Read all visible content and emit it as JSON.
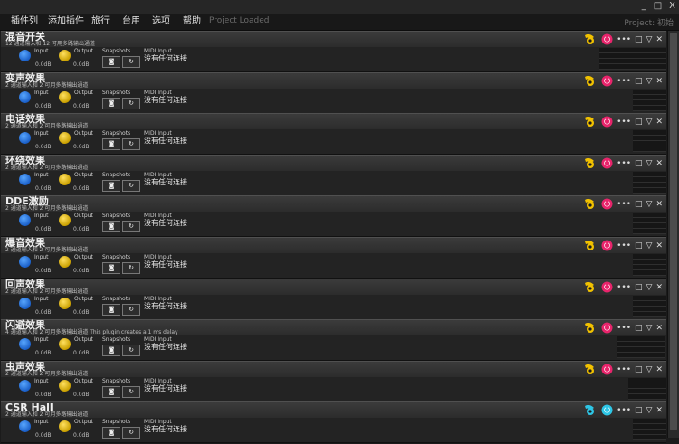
{
  "window": {
    "minimize": "_",
    "maximize": "□",
    "close": "X"
  },
  "menu": [
    "插件列",
    "添加插件",
    "旅行",
    "台用",
    "选项",
    "帮助"
  ],
  "project_status": "Project Loaded",
  "project_name": "Project: 初始",
  "labels": {
    "input": "Input",
    "output": "Output",
    "snapshots": "Snapshots",
    "midi_input": "MIDI Input"
  },
  "plugins": [
    {
      "name": "混音开关",
      "desc": "12 通道输入和 12 可用多路输出通道",
      "input_value": "0.0dB",
      "output_value": "0.0dB",
      "midi_value": "没有任何连接",
      "icon_color": "#f2c200",
      "power_color": "#e8246b",
      "power_symbol": "⏻"
    },
    {
      "name": "变声效果",
      "desc": "2 通道输入和 2 可用多路输出通道",
      "input_value": "0.0dB",
      "output_value": "0.0dB",
      "midi_value": "没有任何连接",
      "icon_color": "#f2c200",
      "power_color": "#e8246b",
      "power_symbol": "⏻"
    },
    {
      "name": "电话效果",
      "desc": "2 通道输入和 2 可用多路输出通道",
      "input_value": "0.0dB",
      "output_value": "0.0dB",
      "midi_value": "没有任何连接",
      "icon_color": "#f2c200",
      "power_color": "#e8246b",
      "power_symbol": "⏻"
    },
    {
      "name": "环绕效果",
      "desc": "2 通道输入和 2 可用多路输出通道",
      "input_value": "0.0dB",
      "output_value": "0.0dB",
      "midi_value": "没有任何连接",
      "icon_color": "#f2c200",
      "power_color": "#e8246b",
      "power_symbol": "⏻"
    },
    {
      "name": "DDE激励",
      "desc": "2 通道输入和 2 可用多路输出通道",
      "input_value": "0.0dB",
      "output_value": "0.0dB",
      "midi_value": "没有任何连接",
      "icon_color": "#f2c200",
      "power_color": "#e8246b",
      "power_symbol": "⏻"
    },
    {
      "name": "爆音效果",
      "desc": "2 通道输入和 2 可用多路输出通道",
      "input_value": "0.0dB",
      "output_value": "0.0dB",
      "midi_value": "没有任何连接",
      "icon_color": "#f2c200",
      "power_color": "#e8246b",
      "power_symbol": "⏻"
    },
    {
      "name": "回声效果",
      "desc": "2 通道输入和 2 可用多路输出通道",
      "input_value": "0.0dB",
      "output_value": "0.0dB",
      "midi_value": "没有任何连接",
      "icon_color": "#f2c200",
      "power_color": "#e8246b",
      "power_symbol": "⏻"
    },
    {
      "name": "闪避效果",
      "desc": "4 通道输入和 2 可用多路输出通道    This plugin creates a 1 ms delay",
      "input_value": "0.0dB",
      "output_value": "0.0dB",
      "midi_value": "没有任何连接",
      "icon_color": "#f2c200",
      "power_color": "#e8246b",
      "power_symbol": "⏻"
    },
    {
      "name": "虫声效果",
      "desc": "2 通道输入和 2 可用多路输出通道",
      "input_value": "0.0dB",
      "output_value": "0.0dB",
      "midi_value": "没有任何连接",
      "icon_color": "#f2c200",
      "power_color": "#e8246b",
      "power_symbol": "⏻"
    },
    {
      "name": "CSR Hall",
      "desc": "2 通道输入和 2 可用多路输出通道",
      "input_value": "0.0dB",
      "output_value": "0.0dB",
      "midi_value": "没有任何连接",
      "icon_color": "#2ec6e6",
      "power_color": "#2ec6e6",
      "power_symbol": "⏻"
    }
  ],
  "header_buttons": {
    "more": "•••",
    "window": "□",
    "collapse": "▽",
    "close": "✕"
  },
  "snapshot_buttons": {
    "camera": "◙",
    "recall": "↻"
  }
}
